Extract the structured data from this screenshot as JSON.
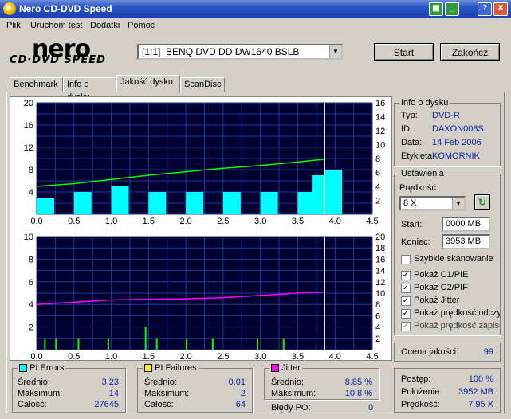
{
  "window": {
    "title": "Nero CD-DVD Speed"
  },
  "menu": [
    "Plik",
    "Uruchom test",
    "Dodatki",
    "Pomoc"
  ],
  "logo": {
    "brand": "nero",
    "product": "CD·DVD SPEED"
  },
  "drive": {
    "selected": "[1:1]  BENQ DVD DD DW1640 BSLB"
  },
  "buttons": {
    "start": "Start",
    "stop": "Zakończ"
  },
  "tabs": [
    "Benchmark",
    "Info o dysku",
    "Jakość dysku",
    "ScanDisc"
  ],
  "active_tab": 2,
  "disc_info": {
    "title": "Info o dysku",
    "rows": [
      {
        "k": "Typ:",
        "v": "DVD-R"
      },
      {
        "k": "ID:",
        "v": "DAXON008S"
      },
      {
        "k": "Data:",
        "v": "14 Feb 2006"
      },
      {
        "k": "Etykieta:",
        "v": "KOMORNIK"
      }
    ]
  },
  "settings": {
    "title": "Ustawienia",
    "speed_label": "Prędkość:",
    "speed_value": "8 X",
    "start_label": "Start:",
    "start_value": "0000 MB",
    "end_label": "Koniec:",
    "end_value": "3953 MB",
    "checkboxes": [
      {
        "label": "Szybkie skanowanie",
        "checked": false,
        "disabled": false
      },
      {
        "label": "Pokaż C1/PIE",
        "checked": true,
        "disabled": false
      },
      {
        "label": "Pokaż C2/PIF",
        "checked": true,
        "disabled": false
      },
      {
        "label": "Pokaż Jitter",
        "checked": true,
        "disabled": false
      },
      {
        "label": "Pokaż prędkość odczytu",
        "checked": true,
        "disabled": false
      },
      {
        "label": "Pokaż prędkość zapisu",
        "checked": true,
        "disabled": true
      }
    ]
  },
  "quality": {
    "label": "Ocena jakości:",
    "value": "99"
  },
  "pi_errors": {
    "title": "PI Errors",
    "color": "#00ffff",
    "rows": [
      {
        "k": "Średnio:",
        "v": "3.23"
      },
      {
        "k": "Maksimum:",
        "v": "14"
      },
      {
        "k": "Całość:",
        "v": "27645"
      }
    ]
  },
  "pi_failures": {
    "title": "PI Failures",
    "color": "#ffff00",
    "rows": [
      {
        "k": "Średnio:",
        "v": "0.01"
      },
      {
        "k": "Maksimum:",
        "v": "2"
      },
      {
        "k": "Całość:",
        "v": "64"
      }
    ]
  },
  "jitter": {
    "title": "Jitter",
    "color": "#ff00ff",
    "rows": [
      {
        "k": "Średnio:",
        "v": "8.85 %"
      },
      {
        "k": "Maksimum:",
        "v": "10.8 %"
      }
    ],
    "po_label": "Błędy PO:",
    "po_value": "0"
  },
  "progress": {
    "rows": [
      {
        "k": "Postęp:",
        "v": "100 %"
      },
      {
        "k": "Położenie:",
        "v": "3952 MB"
      },
      {
        "k": "Prędkość:",
        "v": "7.95 X"
      }
    ]
  },
  "chart_data": [
    {
      "type": "bar",
      "title": "",
      "xlim": [
        0,
        4.5
      ],
      "x_ticks": [
        "0.0",
        "0.5",
        "1.0",
        "1.5",
        "2.0",
        "2.5",
        "3.0",
        "3.5",
        "4.0",
        "4.5"
      ],
      "ylim_left": [
        0,
        20
      ],
      "y_ticks_left": [
        "20",
        "16",
        "12",
        "8",
        "4"
      ],
      "ylim_right": [
        0,
        16
      ],
      "y_ticks_right": [
        "16",
        "14",
        "12",
        "10",
        "8",
        "6",
        "4",
        "2"
      ],
      "series": [
        {
          "type": "bar",
          "color": "#00ffff",
          "x": [
            0.0,
            0.5,
            1.0,
            1.5,
            2.0,
            2.5,
            3.0,
            3.5,
            3.7,
            3.86
          ],
          "values": [
            3,
            4,
            5,
            4,
            4,
            4,
            4,
            4,
            7,
            8
          ]
        },
        {
          "type": "line",
          "color": "#00ff00",
          "x": [
            0.0,
            0.5,
            1.0,
            1.5,
            2.0,
            2.5,
            3.0,
            3.5,
            3.86
          ],
          "values": [
            4.0,
            4.4,
            5.0,
            5.6,
            6.1,
            6.6,
            7.0,
            7.5,
            7.9
          ]
        }
      ],
      "grid": true,
      "end_marker_x": 3.86
    },
    {
      "type": "bar",
      "title": "",
      "xlim": [
        0,
        4.5
      ],
      "x_ticks": [
        "0.0",
        "0.5",
        "1.0",
        "1.5",
        "2.0",
        "2.5",
        "3.0",
        "3.5",
        "4.0",
        "4.5"
      ],
      "ylim_left": [
        0,
        10
      ],
      "y_ticks_left": [
        "10",
        "8",
        "6",
        "4",
        "2"
      ],
      "ylim_right": [
        0,
        20
      ],
      "y_ticks_right": [
        "20",
        "18",
        "16",
        "14",
        "12",
        "10",
        "8",
        "6",
        "4",
        "2"
      ],
      "series": [
        {
          "type": "bar",
          "color": "#00ff00",
          "x": [
            0.1,
            0.25,
            0.55,
            0.95,
            1.45,
            1.6,
            2.0,
            2.35,
            2.95,
            3.3
          ],
          "values": [
            1,
            1,
            1,
            1,
            2,
            1,
            1,
            1,
            1,
            1
          ]
        },
        {
          "type": "line",
          "color": "#ff00ff",
          "x": [
            0.0,
            0.5,
            1.0,
            1.5,
            2.0,
            2.5,
            3.0,
            3.5,
            3.86
          ],
          "values": [
            8.0,
            8.4,
            8.8,
            8.9,
            9.0,
            9.2,
            9.6,
            10.0,
            10.2
          ]
        }
      ],
      "grid": true,
      "end_marker_x": 3.86
    }
  ]
}
